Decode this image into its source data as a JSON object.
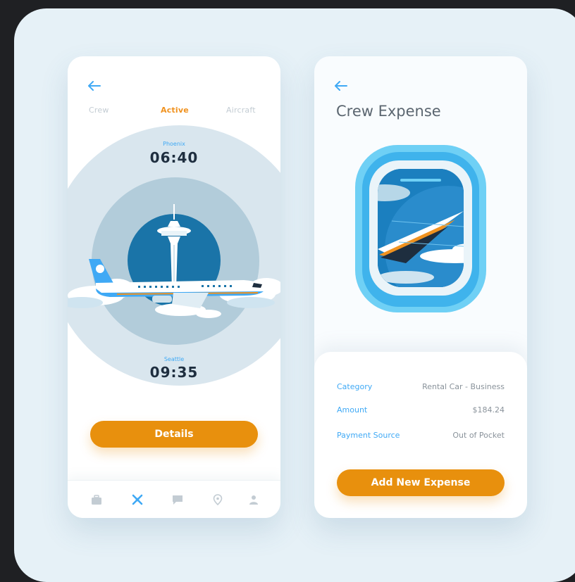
{
  "colors": {
    "accent_orange": "#e8900d",
    "accent_blue": "#3fa9f5",
    "background": "#e6f1f7"
  },
  "left_screen": {
    "back_icon": "arrow-left-icon",
    "tabs": [
      {
        "label": "Crew",
        "active": false
      },
      {
        "label": "Active",
        "active": true
      },
      {
        "label": "Aircraft",
        "active": false
      }
    ],
    "departure": {
      "city": "Phoenix",
      "time": "06:40"
    },
    "arrival": {
      "city": "Seattle",
      "time": "09:35"
    },
    "details_button": "Details",
    "nav": [
      {
        "icon": "briefcase-icon",
        "active": false
      },
      {
        "icon": "plane-icon",
        "active": true
      },
      {
        "icon": "chat-icon",
        "active": false
      },
      {
        "icon": "location-pin-icon",
        "active": false
      },
      {
        "icon": "user-icon",
        "active": false
      }
    ]
  },
  "right_screen": {
    "back_icon": "arrow-left-icon",
    "title": "Crew Expense",
    "rows": [
      {
        "label": "Category",
        "value": "Rental Car - Business"
      },
      {
        "label": "Amount",
        "value": "$184.24"
      },
      {
        "label": "Payment Source",
        "value": "Out of Pocket"
      }
    ],
    "add_button": "Add New Expense"
  }
}
